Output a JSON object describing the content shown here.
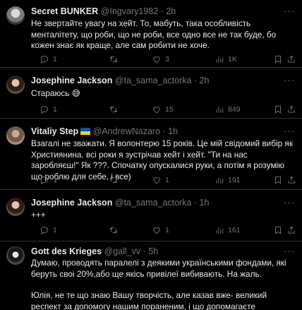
{
  "tweets": [
    {
      "name": "Secret BUNKER",
      "handle": "@Ingvary1982",
      "time": "· 2h",
      "flag": false,
      "text": "Не звертайте увагу на хейт. То, мабуть, така особливість менталітету, що роби, що не роби, все одно все не так буде, бо кожен знає як краще, але сам робити не хоче.",
      "replies": "1",
      "retweets": "",
      "likes": "3",
      "views": "1K"
    },
    {
      "name": "Josephine Jackson",
      "handle": "@ta_sama_actorka",
      "time": "· 2h",
      "flag": false,
      "text": "Стараюсь 😅",
      "replies": "1",
      "retweets": "",
      "likes": "15",
      "views": "849"
    },
    {
      "name": "Vitaliy Step",
      "handle": "@AndrewNazaro",
      "time": "· 1h",
      "flag": true,
      "text": "Взагалі не зважати. Я волонтерю  15 років. Це мій свідомий вибір  як Християнина. всі роки я зустрічав хейт і хейт. \"Ти на нас заробляєш!\" Як ???. Спочатку опускалися руки, а потім я розумію що роблю для себе, і все)",
      "replies": "1",
      "retweets": "",
      "likes": "1",
      "views": "191"
    },
    {
      "name": "Josephine Jackson",
      "handle": "@ta_sama_actorka",
      "time": "· 1h",
      "flag": false,
      "text": "+++",
      "replies": "1",
      "retweets": "",
      "likes": "1",
      "views": "161"
    },
    {
      "name": "Gott des Krieges",
      "handle": "@gall_vv",
      "time": "· 5h",
      "flag": false,
      "text": "Думаю, проводять паралелі з деякими українськими фондами, які беруть своі 20%,або ще якісь привілеї вибивають. На жаль.",
      "text2": "Юлія, не те що знаю Вашу творчість, але казав вже- великий респект за допомогу нашим пораненим, і що допомагаєте Батьківщині."
    }
  ],
  "more_icon": "more-dots",
  "icons": [
    "reply-icon",
    "retweet-icon",
    "like-icon",
    "views-icon",
    "bookmark-icon",
    "share-icon"
  ]
}
